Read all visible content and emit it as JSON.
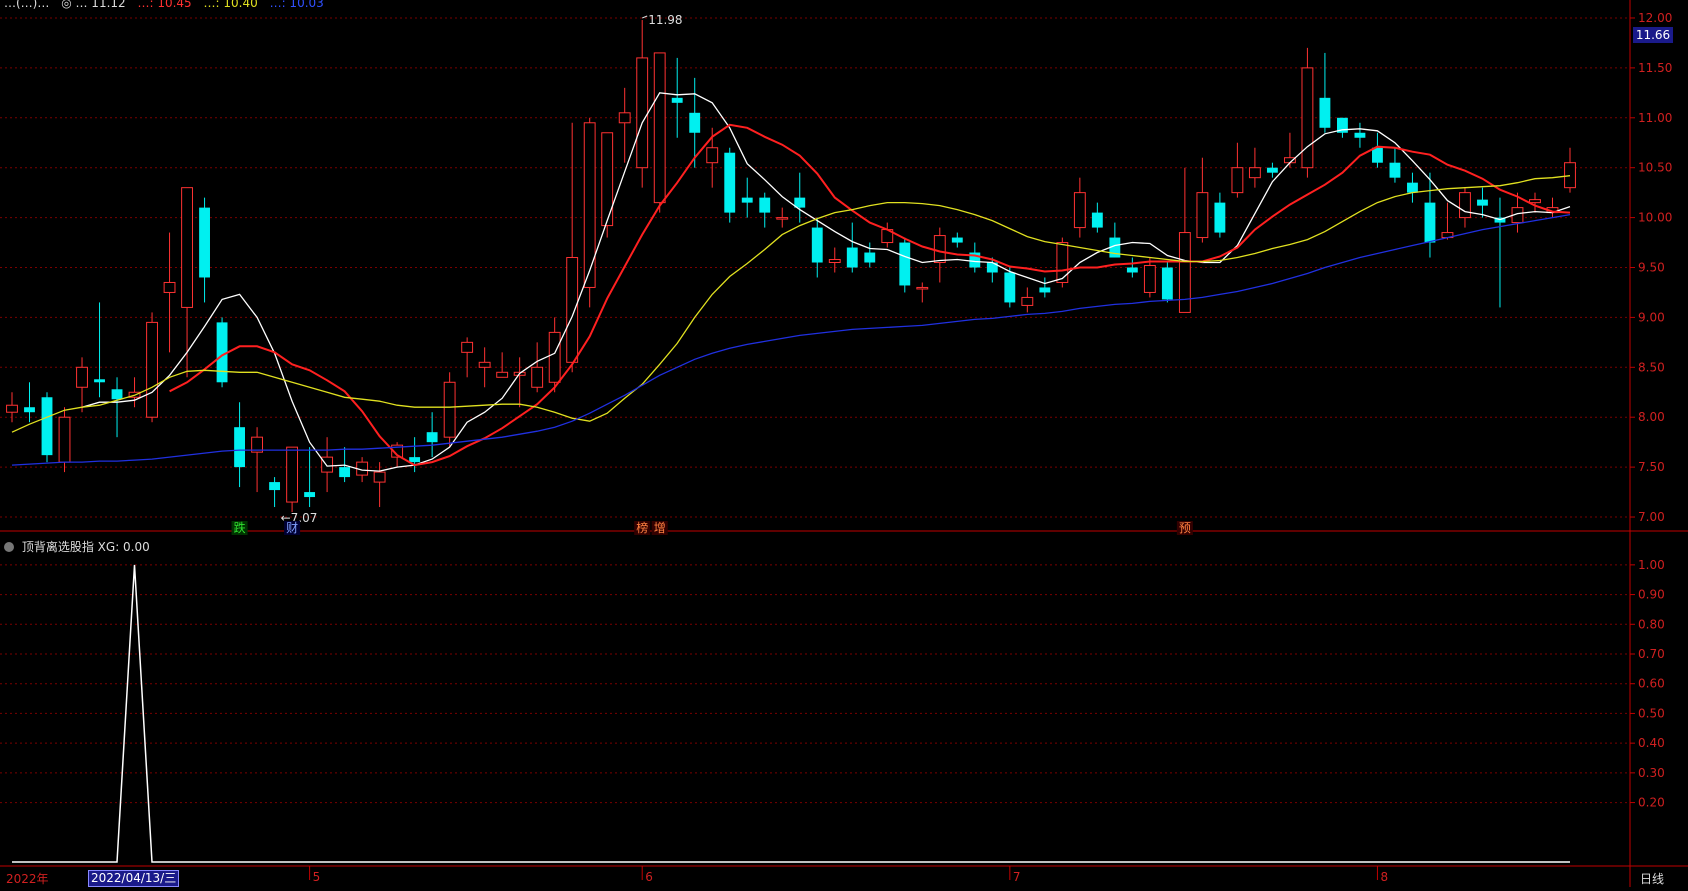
{
  "header": {
    "items": [
      {
        "text": "…(…)…",
        "color": "#dddddd"
      },
      {
        "text": "◎ … 11.12",
        "color": "#dddddd"
      },
      {
        "text": "…: 10.45",
        "color": "#ff3030"
      },
      {
        "text": "…: 10.40",
        "color": "#e0e020"
      },
      {
        "text": "…: 10.03",
        "color": "#3050ff"
      }
    ]
  },
  "current_price": "11.66",
  "indicator": {
    "title": "顶背离选股指",
    "value_label": "XG: 0.00"
  },
  "xaxis": {
    "year_label": "2022年",
    "cursor_date": "2022/04/13/三",
    "period_label": "日线",
    "month_labels": [
      {
        "text": "5",
        "i": 17
      },
      {
        "text": "6",
        "i": 36
      },
      {
        "text": "7",
        "i": 57
      },
      {
        "text": "8",
        "i": 78
      }
    ]
  },
  "colors": {
    "up": "#ff3232",
    "down": "#00f0f0",
    "ma5": "#ffffff",
    "ma10": "#ff2020",
    "ma20": "#e0e020",
    "ma60": "#2030e0",
    "grid": "#7a0000",
    "axis": "#c00000",
    "ind_line": "#ffffff"
  },
  "chart_data": [
    {
      "type": "candlestick",
      "title": "",
      "ylim": [
        6.9,
        12.1
      ],
      "yticks": [
        7.0,
        7.5,
        8.0,
        8.5,
        9.0,
        9.5,
        10.0,
        10.5,
        11.0,
        11.5,
        12.0
      ],
      "ytick_labels": [
        "7.00",
        "7.50",
        "8.00",
        "8.50",
        "9.00",
        "9.50",
        "10.00",
        "10.50",
        "11.00",
        "11.50",
        "12.00"
      ],
      "candles": [
        [
          8.05,
          8.25,
          7.95,
          8.12
        ],
        [
          8.1,
          8.35,
          7.95,
          8.05
        ],
        [
          8.2,
          8.25,
          7.55,
          7.62
        ],
        [
          7.55,
          8.1,
          7.45,
          8.0
        ],
        [
          8.3,
          8.6,
          8.05,
          8.5
        ],
        [
          8.38,
          9.15,
          8.2,
          8.35
        ],
        [
          8.28,
          8.4,
          7.8,
          8.18
        ],
        [
          8.2,
          8.4,
          8.1,
          8.25
        ],
        [
          8.0,
          9.05,
          7.95,
          8.95
        ],
        [
          9.25,
          9.85,
          8.65,
          9.35
        ],
        [
          9.1,
          10.25,
          8.4,
          10.3
        ],
        [
          10.1,
          10.2,
          9.15,
          9.4
        ],
        [
          8.95,
          9.0,
          8.3,
          8.35
        ],
        [
          7.9,
          8.15,
          7.3,
          7.5
        ],
        [
          7.65,
          7.9,
          7.25,
          7.8
        ],
        [
          7.35,
          7.4,
          7.1,
          7.27
        ],
        [
          7.15,
          7.7,
          7.05,
          7.7
        ],
        [
          7.25,
          7.7,
          7.1,
          7.2
        ],
        [
          7.45,
          7.8,
          7.25,
          7.6
        ],
        [
          7.5,
          7.7,
          7.35,
          7.4
        ],
        [
          7.42,
          7.6,
          7.35,
          7.55
        ],
        [
          7.35,
          7.55,
          7.1,
          7.45
        ],
        [
          7.6,
          7.75,
          7.5,
          7.72
        ],
        [
          7.6,
          7.8,
          7.45,
          7.55
        ],
        [
          7.85,
          8.05,
          7.6,
          7.75
        ],
        [
          7.8,
          8.45,
          7.7,
          8.35
        ],
        [
          8.65,
          8.8,
          8.4,
          8.75
        ],
        [
          8.5,
          8.7,
          8.3,
          8.55
        ],
        [
          8.4,
          8.65,
          8.4,
          8.45
        ],
        [
          8.42,
          8.6,
          8.1,
          8.45
        ],
        [
          8.3,
          8.75,
          8.25,
          8.5
        ],
        [
          8.35,
          9.0,
          8.25,
          8.85
        ],
        [
          8.55,
          10.95,
          8.45,
          9.6
        ],
        [
          9.3,
          11.0,
          9.1,
          10.95
        ],
        [
          9.92,
          10.85,
          9.8,
          10.85
        ],
        [
          10.95,
          11.3,
          10.55,
          11.05
        ],
        [
          10.5,
          11.98,
          10.3,
          11.6
        ],
        [
          10.15,
          10.7,
          10.05,
          11.65
        ],
        [
          11.2,
          11.6,
          10.8,
          11.15
        ],
        [
          11.05,
          11.4,
          10.5,
          10.85
        ],
        [
          10.55,
          10.9,
          10.3,
          10.7
        ],
        [
          10.65,
          10.7,
          9.95,
          10.05
        ],
        [
          10.2,
          10.4,
          10.0,
          10.15
        ],
        [
          10.2,
          10.25,
          9.9,
          10.05
        ],
        [
          10.0,
          10.1,
          9.9,
          10.0
        ],
        [
          10.2,
          10.45,
          9.95,
          10.1
        ],
        [
          9.9,
          10.0,
          9.4,
          9.55
        ],
        [
          9.55,
          9.7,
          9.45,
          9.58
        ],
        [
          9.7,
          9.95,
          9.45,
          9.5
        ],
        [
          9.65,
          9.75,
          9.5,
          9.55
        ],
        [
          9.75,
          9.95,
          9.7,
          9.88
        ],
        [
          9.75,
          9.8,
          9.25,
          9.32
        ],
        [
          9.3,
          9.35,
          9.15,
          9.3
        ],
        [
          9.55,
          9.9,
          9.35,
          9.82
        ],
        [
          9.8,
          9.85,
          9.7,
          9.75
        ],
        [
          9.65,
          9.75,
          9.45,
          9.5
        ],
        [
          9.55,
          9.6,
          9.35,
          9.45
        ],
        [
          9.45,
          9.5,
          9.1,
          9.15
        ],
        [
          9.12,
          9.3,
          9.05,
          9.2
        ],
        [
          9.3,
          9.4,
          9.2,
          9.25
        ],
        [
          9.35,
          9.8,
          9.3,
          9.75
        ],
        [
          9.9,
          10.4,
          9.8,
          10.25
        ],
        [
          10.05,
          10.15,
          9.85,
          9.9
        ],
        [
          9.8,
          9.95,
          9.6,
          9.6
        ],
        [
          9.5,
          9.6,
          9.4,
          9.45
        ],
        [
          9.25,
          9.6,
          9.2,
          9.52
        ],
        [
          9.5,
          9.55,
          9.15,
          9.18
        ],
        [
          9.05,
          10.5,
          9.05,
          9.85
        ],
        [
          9.8,
          10.6,
          9.75,
          10.25
        ],
        [
          10.15,
          10.25,
          9.8,
          9.85
        ],
        [
          10.25,
          10.75,
          10.2,
          10.5
        ],
        [
          10.4,
          10.7,
          10.3,
          10.5
        ],
        [
          10.5,
          10.55,
          10.4,
          10.45
        ],
        [
          10.55,
          10.85,
          10.5,
          10.6
        ],
        [
          10.5,
          11.7,
          10.4,
          11.5
        ],
        [
          11.2,
          11.65,
          10.85,
          10.9
        ],
        [
          11.0,
          11.0,
          10.8,
          10.85
        ],
        [
          10.85,
          10.95,
          10.7,
          10.8
        ],
        [
          10.7,
          10.85,
          10.5,
          10.55
        ],
        [
          10.55,
          10.7,
          10.35,
          10.4
        ],
        [
          10.35,
          10.45,
          10.15,
          10.25
        ],
        [
          10.15,
          10.45,
          9.6,
          9.75
        ],
        [
          9.8,
          10.15,
          9.78,
          9.85
        ],
        [
          10.0,
          10.3,
          9.9,
          10.25
        ],
        [
          10.18,
          10.3,
          10.0,
          10.12
        ],
        [
          10.0,
          10.2,
          9.1,
          9.95
        ],
        [
          9.95,
          10.25,
          9.85,
          10.1
        ],
        [
          10.15,
          10.25,
          10.05,
          10.18
        ],
        [
          10.05,
          10.2,
          10.0,
          10.1
        ],
        [
          10.3,
          10.7,
          10.25,
          10.55
        ]
      ],
      "series": [
        {
          "name": "MA5",
          "color": "#ffffff",
          "values": [
            null,
            null,
            null,
            null,
            8.1,
            8.15,
            8.15,
            8.17,
            8.25,
            8.42,
            8.65,
            8.91,
            9.18,
            9.23,
            9.0,
            8.64,
            8.16,
            7.75,
            7.51,
            7.52,
            7.47,
            7.46,
            7.5,
            7.52,
            7.58,
            7.7,
            7.95,
            8.05,
            8.19,
            8.44,
            8.56,
            8.64,
            9.01,
            9.47,
            9.97,
            10.46,
            10.95,
            11.25,
            11.23,
            11.24,
            11.15,
            10.9,
            10.54,
            10.38,
            10.21,
            10.08,
            9.97,
            9.86,
            9.76,
            9.69,
            9.68,
            9.61,
            9.55,
            9.57,
            9.58,
            9.56,
            9.55,
            9.46,
            9.4,
            9.34,
            9.39,
            9.55,
            9.65,
            9.72,
            9.75,
            9.74,
            9.62,
            9.57,
            9.55,
            9.55,
            9.72,
            10.04,
            10.36,
            10.55,
            10.71,
            10.84,
            10.88,
            10.89,
            10.87,
            10.75,
            10.57,
            10.38,
            10.17,
            10.06,
            10.03,
            9.98,
            10.04,
            10.06,
            10.05,
            10.11
          ]
        },
        {
          "name": "MA10",
          "color": "#ff2020",
          "values": [
            null,
            null,
            null,
            null,
            null,
            null,
            null,
            null,
            null,
            8.26,
            8.35,
            8.48,
            8.62,
            8.71,
            8.71,
            8.65,
            8.53,
            8.47,
            8.37,
            8.26,
            8.06,
            7.81,
            7.62,
            7.52,
            7.55,
            7.61,
            7.71,
            7.79,
            7.89,
            8.01,
            8.13,
            8.3,
            8.53,
            8.81,
            9.19,
            9.51,
            9.83,
            10.12,
            10.35,
            10.6,
            10.81,
            10.93,
            10.9,
            10.81,
            10.73,
            10.62,
            10.44,
            10.2,
            10.07,
            9.95,
            9.88,
            9.79,
            9.71,
            9.66,
            9.63,
            9.62,
            9.58,
            9.51,
            9.49,
            9.46,
            9.47,
            9.5,
            9.5,
            9.53,
            9.54,
            9.56,
            9.56,
            9.56,
            9.56,
            9.61,
            9.7,
            9.88,
            10.01,
            10.13,
            10.23,
            10.33,
            10.45,
            10.62,
            10.71,
            10.7,
            10.66,
            10.63,
            10.53,
            10.47,
            10.39,
            10.28,
            10.21,
            10.12,
            10.06,
            10.05
          ]
        },
        {
          "name": "MA20",
          "color": "#e0e020",
          "values": [
            7.85,
            7.93,
            8.0,
            8.07,
            8.1,
            8.12,
            8.17,
            8.22,
            8.3,
            8.4,
            8.46,
            8.47,
            8.46,
            8.45,
            8.45,
            8.4,
            8.35,
            8.3,
            8.25,
            8.2,
            8.18,
            8.16,
            8.12,
            8.1,
            8.1,
            8.1,
            8.11,
            8.12,
            8.13,
            8.13,
            8.1,
            8.05,
            7.99,
            7.96,
            8.04,
            8.19,
            8.33,
            8.53,
            8.74,
            9.0,
            9.23,
            9.41,
            9.54,
            9.68,
            9.83,
            9.92,
            9.99,
            10.05,
            10.08,
            10.12,
            10.15,
            10.15,
            10.14,
            10.12,
            10.08,
            10.03,
            9.97,
            9.89,
            9.81,
            9.76,
            9.73,
            9.7,
            9.67,
            9.64,
            9.62,
            9.6,
            9.58,
            9.56,
            9.56,
            9.57,
            9.6,
            9.64,
            9.69,
            9.73,
            9.78,
            9.86,
            9.96,
            10.06,
            10.15,
            10.21,
            10.25,
            10.27,
            10.29,
            10.3,
            10.31,
            10.32,
            10.35,
            10.39,
            10.4,
            10.42
          ]
        },
        {
          "name": "MA60",
          "color": "#2030e0",
          "values": [
            7.52,
            7.53,
            7.54,
            7.55,
            7.55,
            7.56,
            7.56,
            7.57,
            7.58,
            7.6,
            7.62,
            7.64,
            7.66,
            7.67,
            7.67,
            7.67,
            7.67,
            7.67,
            7.67,
            7.68,
            7.68,
            7.69,
            7.7,
            7.71,
            7.72,
            7.74,
            7.76,
            7.78,
            7.8,
            7.83,
            7.86,
            7.9,
            7.96,
            8.04,
            8.13,
            8.22,
            8.32,
            8.42,
            8.5,
            8.58,
            8.64,
            8.69,
            8.73,
            8.76,
            8.79,
            8.82,
            8.84,
            8.86,
            8.88,
            8.89,
            8.9,
            8.91,
            8.92,
            8.94,
            8.96,
            8.98,
            8.99,
            9.01,
            9.03,
            9.04,
            9.06,
            9.09,
            9.11,
            9.13,
            9.14,
            9.16,
            9.17,
            9.18,
            9.2,
            9.23,
            9.26,
            9.3,
            9.34,
            9.39,
            9.44,
            9.5,
            9.55,
            9.6,
            9.64,
            9.68,
            9.72,
            9.76,
            9.8,
            9.84,
            9.88,
            9.91,
            9.94,
            9.97,
            10.0,
            10.03
          ]
        }
      ],
      "annotations": [
        {
          "text": "11.98",
          "i": 36,
          "y": 11.98,
          "arrow": "left-up"
        },
        {
          "text": "←7.07",
          "i": 15,
          "y": 7.07
        }
      ],
      "markers": [
        {
          "text": "跌",
          "i": 13,
          "color": "#30e030",
          "bg": "#003300"
        },
        {
          "text": "财",
          "i": 16,
          "color": "#80a0ff",
          "bg": "#000033"
        },
        {
          "text": "榜",
          "i": 36,
          "color": "#ff8040",
          "bg": "#330000"
        },
        {
          "text": "增",
          "i": 37,
          "color": "#ff8040",
          "bg": "#330000"
        },
        {
          "text": "预",
          "i": 67,
          "color": "#ff8040",
          "bg": "#330000"
        }
      ]
    },
    {
      "type": "line",
      "title": "",
      "ylim": [
        0,
        1.05
      ],
      "ytick_labels": [
        "0.20",
        "0.30",
        "0.40",
        "0.50",
        "0.60",
        "0.70",
        "0.80",
        "0.90",
        "1.00"
      ],
      "yticks": [
        0.2,
        0.3,
        0.4,
        0.5,
        0.6,
        0.7,
        0.8,
        0.9,
        1.0
      ],
      "series": [
        {
          "name": "XG",
          "color": "#ffffff",
          "values": [
            0,
            0,
            0,
            0,
            0,
            0,
            0,
            1,
            0,
            0,
            0,
            0,
            0,
            0,
            0,
            0,
            0,
            0,
            0,
            0,
            0,
            0,
            0,
            0,
            0,
            0,
            0,
            0,
            0,
            0,
            0,
            0,
            0,
            0,
            0,
            0,
            0,
            0,
            0,
            0,
            0,
            0,
            0,
            0,
            0,
            0,
            0,
            0,
            0,
            0,
            0,
            0,
            0,
            0,
            0,
            0,
            0,
            0,
            0,
            0,
            0,
            0,
            0,
            0,
            0,
            0,
            0,
            0,
            0,
            0,
            0,
            0,
            0,
            0,
            0,
            0,
            0,
            0,
            0,
            0,
            0,
            0,
            0,
            0,
            0,
            0,
            0,
            0,
            0,
            0
          ]
        }
      ]
    }
  ]
}
